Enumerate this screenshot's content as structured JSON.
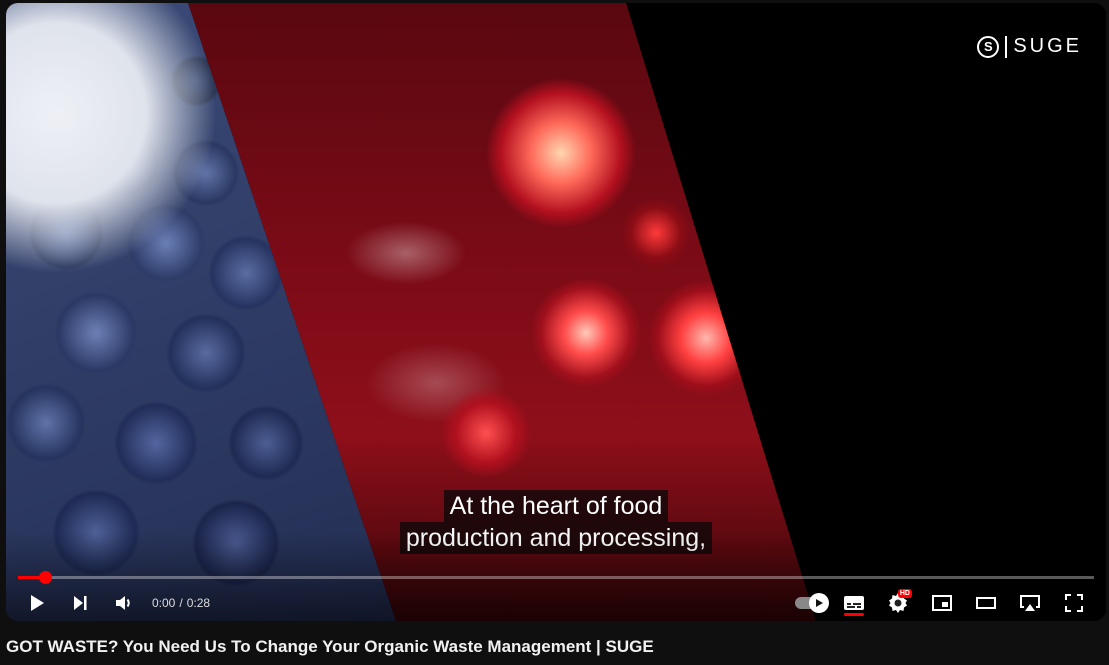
{
  "video": {
    "brand_text": "SUGE",
    "captions": [
      "At the heart of food",
      "production and processing,"
    ],
    "progress_fraction": 0.025
  },
  "controls": {
    "current_time": "0:00",
    "separator": "/",
    "duration": "0:28",
    "icons": {
      "play": "play-icon",
      "next": "next-icon",
      "volume": "volume-icon",
      "autoplay": "autoplay-toggle",
      "captions": "captions-icon",
      "settings": "settings-icon",
      "miniplayer": "miniplayer-icon",
      "theater": "theater-icon",
      "airplay": "airplay-icon",
      "fullscreen": "fullscreen-icon"
    },
    "hd_badge": "HD"
  },
  "page": {
    "title": "GOT WASTE? You Need Us To Change Your Organic Waste Management | SUGE"
  },
  "colors": {
    "accent": "#ff0000",
    "background": "#0f0f0f"
  }
}
